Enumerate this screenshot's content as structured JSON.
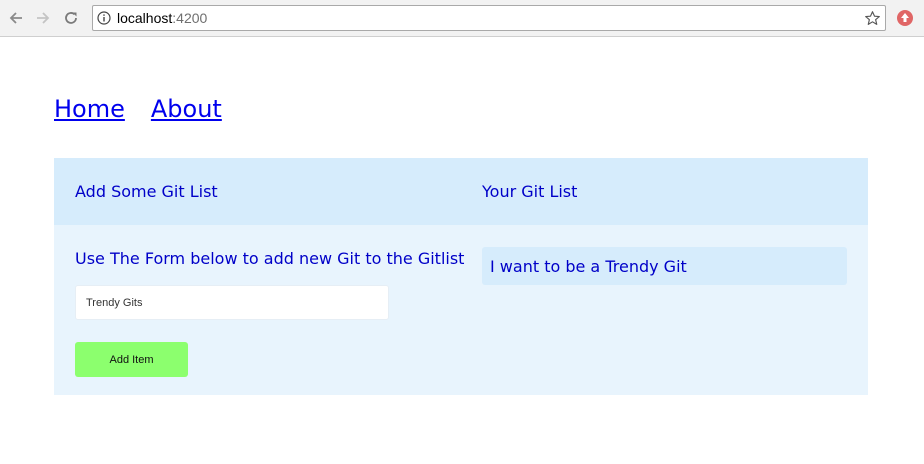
{
  "browser": {
    "url_host": "localhost",
    "url_port": ":4200",
    "icons": [
      "back-arrow-icon",
      "forward-arrow-icon",
      "reload-icon",
      "info-icon",
      "star-icon",
      "extension-icon"
    ]
  },
  "nav": {
    "home_label": "Home",
    "about_label": "About"
  },
  "panel": {
    "left_header": "Add Some Git List",
    "right_header": "Your Git List",
    "instructions": "Use The Form below to add new Git to the Gitlist",
    "input_value": "Trendy Gits",
    "add_button_label": "Add Item",
    "git_items": [
      {
        "label": "I want to be a Trendy Git"
      }
    ]
  },
  "colors": {
    "header_bg": "#d6ecfc",
    "panel_bg": "#e8f4fd",
    "text_blue": "#0000c8",
    "button_green": "#8cff6e"
  }
}
